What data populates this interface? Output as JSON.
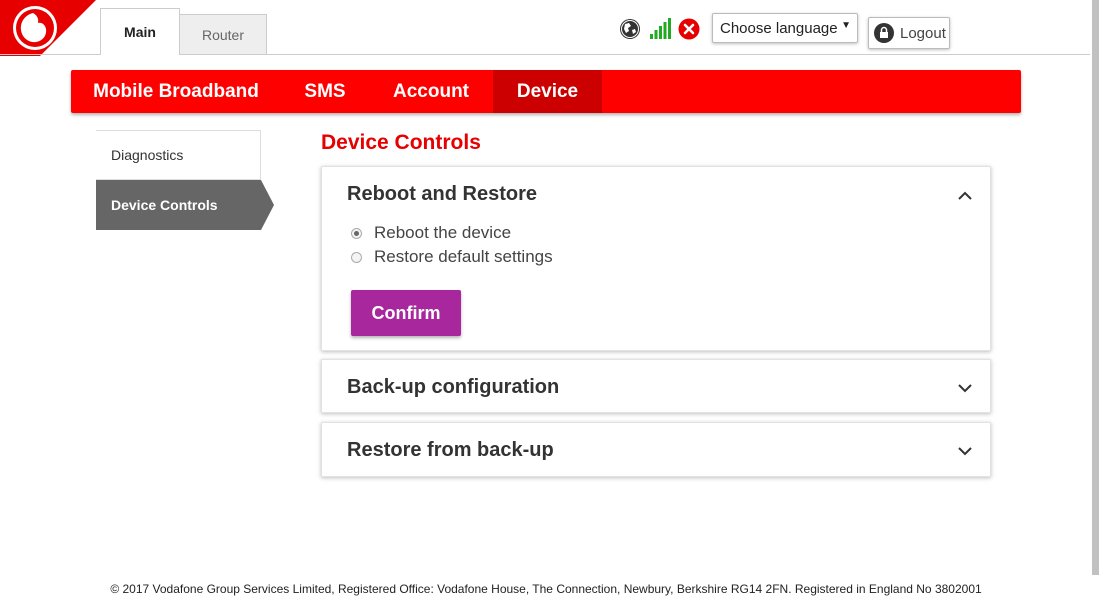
{
  "header": {
    "tabs": [
      {
        "label": "Main",
        "active": true
      },
      {
        "label": "Router",
        "active": false
      }
    ],
    "status_icons": [
      "globe-icon",
      "signal-strength-icon",
      "disconnected-icon"
    ],
    "language_select": {
      "value": "Choose language"
    },
    "logout_label": "Logout"
  },
  "nav": {
    "items": [
      {
        "label": "Mobile Broadband"
      },
      {
        "label": "SMS"
      },
      {
        "label": "Account"
      },
      {
        "label": "Device",
        "active": true
      }
    ]
  },
  "sidebar": {
    "items": [
      {
        "label": "Diagnostics"
      },
      {
        "label": "Device Controls",
        "active": true
      }
    ]
  },
  "content": {
    "title": "Device Controls",
    "panels": [
      {
        "title": "Reboot and Restore",
        "expanded": true,
        "options": [
          "Reboot the device",
          "Restore default settings"
        ],
        "selected": "Reboot the device",
        "confirm_label": "Confirm"
      },
      {
        "title": "Back-up configuration",
        "expanded": false
      },
      {
        "title": "Restore from back-up",
        "expanded": false
      }
    ]
  },
  "footer": {
    "text": "© 2017 Vodafone Group Services Limited, Registered Office: Vodafone House, The Connection, Newbury, Berkshire RG14 2FN. Registered in England No 3802001"
  },
  "colors": {
    "brand_red": "#ff0000",
    "active_nav": "#cc0000",
    "confirm_purple": "#a8279c",
    "title_red": "#e60000",
    "sidebar_active": "#666666"
  }
}
